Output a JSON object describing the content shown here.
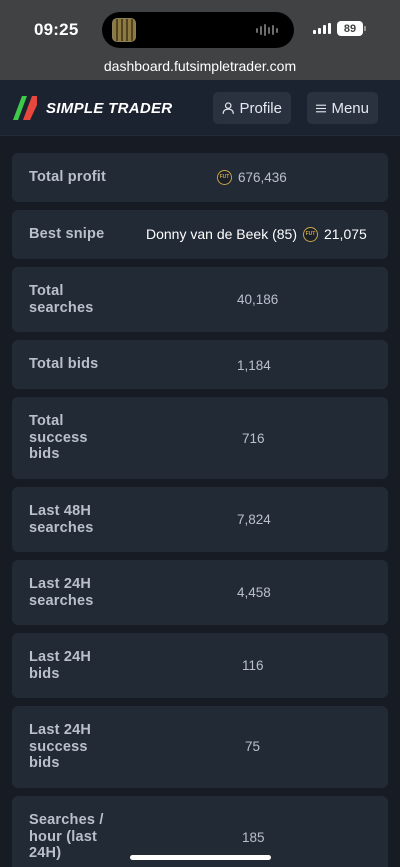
{
  "status_bar": {
    "time": "09:25",
    "battery": "89",
    "url": "dashboard.futsimpletrader.com"
  },
  "header": {
    "brand": "SIMPLE TRADER",
    "profile_label": "Profile",
    "menu_label": "Menu",
    "colors": {
      "logo_green": "#3ec94a",
      "logo_red": "#e8473d"
    }
  },
  "stats": {
    "total_profit": {
      "label": "Total profit",
      "value": "676,436",
      "icon": "fut-coin-icon"
    },
    "best_snipe": {
      "label": "Best snipe",
      "player": "Donny van de Beek (85)",
      "value": "21,075",
      "icon": "fut-coin-icon"
    },
    "total_searches": {
      "label": "Total searches",
      "value": "40,186"
    },
    "total_bids": {
      "label": "Total bids",
      "value": "1,184"
    },
    "total_success_bids": {
      "label": "Total success bids",
      "value": "716"
    },
    "last_48h_searches": {
      "label": "Last 48H searches",
      "value": "7,824"
    },
    "last_24h_searches": {
      "label": "Last 24H searches",
      "value": "4,458"
    },
    "last_24h_bids": {
      "label": "Last 24H bids",
      "value": "116"
    },
    "last_24h_success_bids": {
      "label": "Last 24H success bids",
      "value": "75"
    },
    "searches_per_hour": {
      "label": "Searches / hour (last 24H)",
      "value": "185"
    }
  }
}
